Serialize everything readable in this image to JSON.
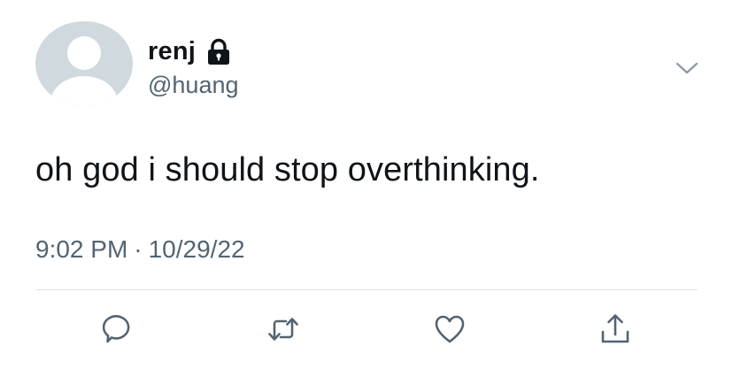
{
  "user": {
    "display_name": "renj",
    "handle": "@huang",
    "protected": true
  },
  "tweet": {
    "text": "oh god i should stop overthinking.",
    "time": "9:02 PM",
    "separator": "·",
    "date": "10/29/22"
  },
  "icons": {
    "avatar": "default-avatar-icon",
    "lock": "lock-icon",
    "menu": "chevron-down-icon",
    "reply": "reply-icon",
    "retweet": "retweet-icon",
    "like": "heart-icon",
    "share": "share-icon"
  },
  "colors": {
    "text": "#0f1419",
    "secondary": "#536471",
    "icon": "#536471",
    "avatar_bg": "#cfd9de",
    "divider": "#dfe4e8"
  }
}
